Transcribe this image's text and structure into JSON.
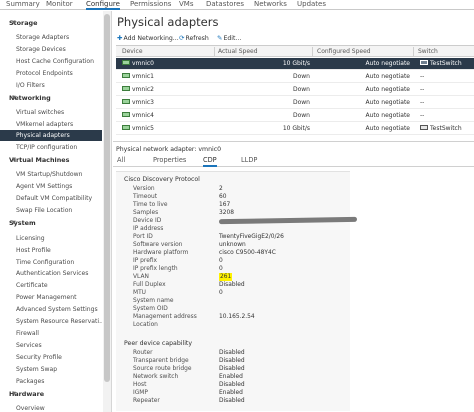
{
  "top_tabs": [
    "Summary",
    "Monitor",
    "Configure",
    "Permissions",
    "VMs",
    "Datastores",
    "Networks",
    "Updates"
  ],
  "active_top_tab": "Configure",
  "nav": {
    "groups": [
      {
        "label": "Storage",
        "items": [
          "Storage Adapters",
          "Storage Devices",
          "Host Cache Configuration",
          "Protocol Endpoints",
          "I/O Filters"
        ]
      },
      {
        "label": "Networking",
        "items": [
          "Virtual switches",
          "VMkernel adapters",
          "Physical adapters",
          "TCP/IP configuration"
        ]
      },
      {
        "label": "Virtual Machines",
        "items": [
          "VM Startup/Shutdown",
          "Agent VM Settings",
          "Default VM Compatibility",
          "Swap File Location"
        ]
      },
      {
        "label": "System",
        "items": [
          "Licensing",
          "Host Profile",
          "Time Configuration",
          "Authentication Services",
          "Certificate",
          "Power Management",
          "Advanced System Settings",
          "System Resource Reservati...",
          "Firewall",
          "Services",
          "Security Profile",
          "System Swap",
          "Packages"
        ]
      },
      {
        "label": "Hardware",
        "items": [
          "Overview"
        ]
      }
    ],
    "selected": "Physical adapters"
  },
  "page_title": "Physical adapters",
  "toolbar": {
    "add_label": "Add Networking...",
    "refresh_label": "Refresh",
    "edit_label": "Edit..."
  },
  "grid": {
    "columns": [
      "Device",
      "Actual Speed",
      "Configured Speed",
      "Switch"
    ],
    "rows": [
      {
        "device": "vmnic0",
        "actual_speed": "10 Gbit/s",
        "configured_speed": "Auto negotiate",
        "switch": "TestSwitch",
        "selected": true
      },
      {
        "device": "vmnic1",
        "actual_speed": "Down",
        "configured_speed": "Auto negotiate",
        "switch": "--"
      },
      {
        "device": "vmnic2",
        "actual_speed": "Down",
        "configured_speed": "Auto negotiate",
        "switch": "--"
      },
      {
        "device": "vmnic3",
        "actual_speed": "Down",
        "configured_speed": "Auto negotiate",
        "switch": "--"
      },
      {
        "device": "vmnic4",
        "actual_speed": "Down",
        "configured_speed": "Auto negotiate",
        "switch": "--"
      },
      {
        "device": "vmnic5",
        "actual_speed": "10 Gbit/s",
        "configured_speed": "Auto negotiate",
        "switch": "TestSwitch"
      }
    ]
  },
  "detail": {
    "title": "Physical network adapter: vmnic0",
    "tabs": [
      "All",
      "Properties",
      "CDP",
      "LLDP"
    ],
    "active_tab": "CDP",
    "cdp_heading": "Cisco Discovery Protocol",
    "properties": [
      {
        "label": "Version",
        "value": "2"
      },
      {
        "label": "Timeout",
        "value": "60"
      },
      {
        "label": "Time to live",
        "value": "167"
      },
      {
        "label": "Samples",
        "value": "3208"
      },
      {
        "label": "Device ID",
        "value": ""
      },
      {
        "label": "IP address",
        "value": ""
      },
      {
        "label": "Port ID",
        "value": "TwentyFiveGigE2/0/26"
      },
      {
        "label": "Software version",
        "value": "unknown"
      },
      {
        "label": "Hardware platform",
        "value": "cisco C9500-48Y4C"
      },
      {
        "label": "IP prefix",
        "value": "0"
      },
      {
        "label": "IP prefix length",
        "value": "0"
      },
      {
        "label": "VLAN",
        "value": "261",
        "highlight": true
      },
      {
        "label": "Full Duplex",
        "value": "Disabled"
      },
      {
        "label": "MTU",
        "value": "0"
      },
      {
        "label": "System name",
        "value": ""
      },
      {
        "label": "System OID",
        "value": ""
      },
      {
        "label": "Management address",
        "value": "10.165.2.54"
      },
      {
        "label": "Location",
        "value": ""
      }
    ],
    "capability_heading": "Peer device capability",
    "capabilities": [
      {
        "label": "Router",
        "value": "Disabled"
      },
      {
        "label": "Transparent bridge",
        "value": "Disabled"
      },
      {
        "label": "Source route bridge",
        "value": "Disabled"
      },
      {
        "label": "Network switch",
        "value": "Enabled"
      },
      {
        "label": "Host",
        "value": "Disabled"
      },
      {
        "label": "IGMP",
        "value": "Enabled"
      },
      {
        "label": "Repeater",
        "value": "Disabled"
      }
    ]
  },
  "colors": {
    "accent": "#1b75bb",
    "selected_row": "#2b3a4a",
    "highlight": "#fff200"
  }
}
